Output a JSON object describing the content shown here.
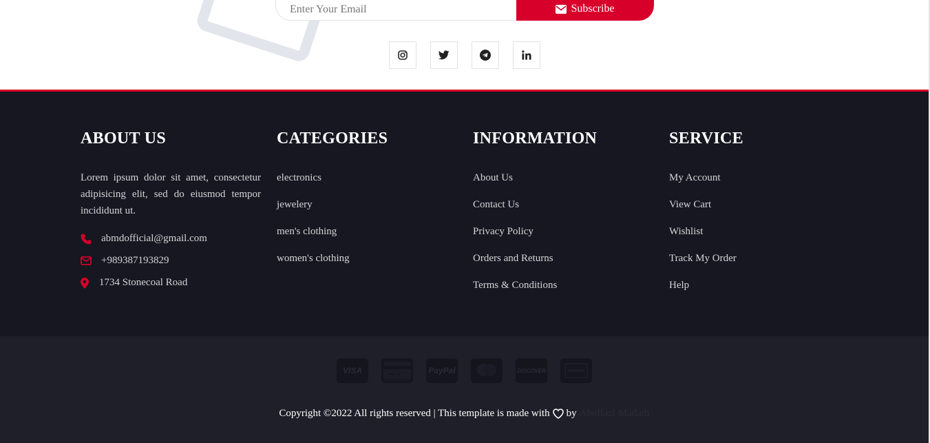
{
  "newsletter": {
    "email_placeholder": "Enter Your Email",
    "subscribe_label": "Subscribe"
  },
  "socials": [
    {
      "icon": "instagram-icon"
    },
    {
      "icon": "twitter-icon"
    },
    {
      "icon": "telegram-icon"
    },
    {
      "icon": "linkedin-icon"
    }
  ],
  "footer": {
    "about": {
      "title": "ABOUT US",
      "text": "Lorem ipsum dolor sit amet, consectetur adipisicing elit, sed do eiusmod tempor incididunt ut.",
      "email": "abmdofficial@gmail.com",
      "phone": "+989387193829",
      "address": "1734 Stonecoal Road"
    },
    "categories": {
      "title": "CATEGORIES",
      "items": [
        "electronics",
        "jewelery",
        "men's clothing",
        "women's clothing"
      ]
    },
    "information": {
      "title": "INFORMATION",
      "items": [
        "About Us",
        "Contact Us",
        "Privacy Policy",
        "Orders and Returns",
        "Terms & Conditions"
      ]
    },
    "service": {
      "title": "SERVICE",
      "items": [
        "My Account",
        "View Cart",
        "Wishlist",
        "Track My Order",
        "Help"
      ]
    }
  },
  "payments": [
    {
      "label": "VISA",
      "icon": "visa-icon"
    },
    {
      "label": "",
      "icon": "credit-card-icon"
    },
    {
      "label": "PayPal",
      "icon": "paypal-icon"
    },
    {
      "label": "",
      "icon": "mastercard-icon"
    },
    {
      "label": "DISCOVER",
      "icon": "discover-icon"
    },
    {
      "label": "",
      "icon": "amex-icon"
    }
  ],
  "copyright": {
    "text": "Copyright ©2022 All rights reserved | This template is made with",
    "by": "by",
    "author": "Abolfazl Madadi"
  },
  "colors": {
    "accent": "#d6002a",
    "footer_bg": "#161720",
    "bottom_bg": "#1e1f29"
  }
}
